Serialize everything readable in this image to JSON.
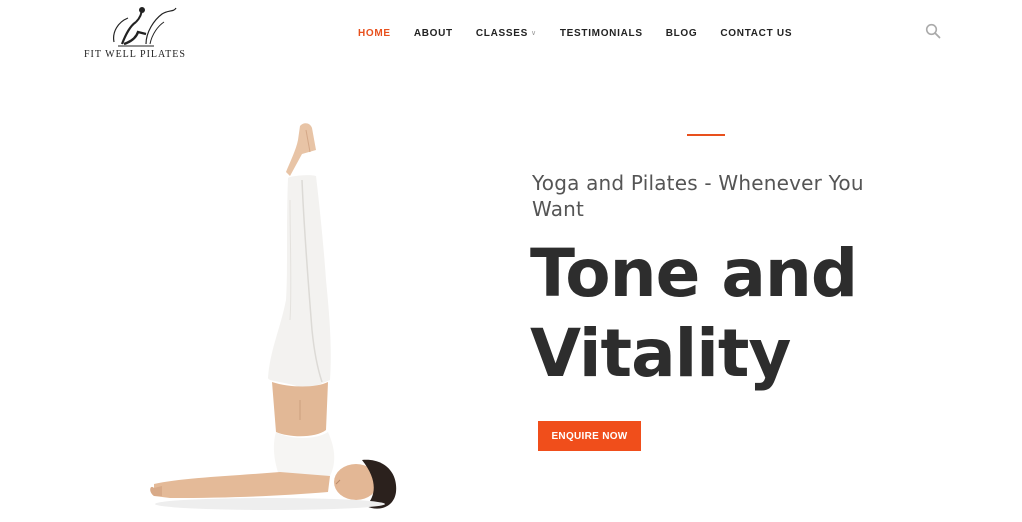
{
  "brand": {
    "name": "Fit Well Pilates",
    "logo_icon": "pilates-figure-logo-icon"
  },
  "nav": {
    "items": [
      {
        "label": "HOME",
        "active": true
      },
      {
        "label": "ABOUT",
        "active": false
      },
      {
        "label": "CLASSES",
        "active": false,
        "has_dropdown": true
      },
      {
        "label": "TESTIMONIALS",
        "active": false
      },
      {
        "label": "BLOG",
        "active": false
      },
      {
        "label": "CONTACT US",
        "active": false
      }
    ],
    "search_icon": "search-icon"
  },
  "hero": {
    "subtitle": "Yoga and Pilates - Whenever You Want",
    "title_line1": "Tone and",
    "title_line2": "Vitality",
    "cta_label": "ENQUIRE NOW",
    "image": "woman-shoulder-stand-pose-photo"
  },
  "colors": {
    "accent": "#e8501d",
    "button": "#f04e1b",
    "title": "#2d2d2d",
    "subtitle": "#555555"
  }
}
